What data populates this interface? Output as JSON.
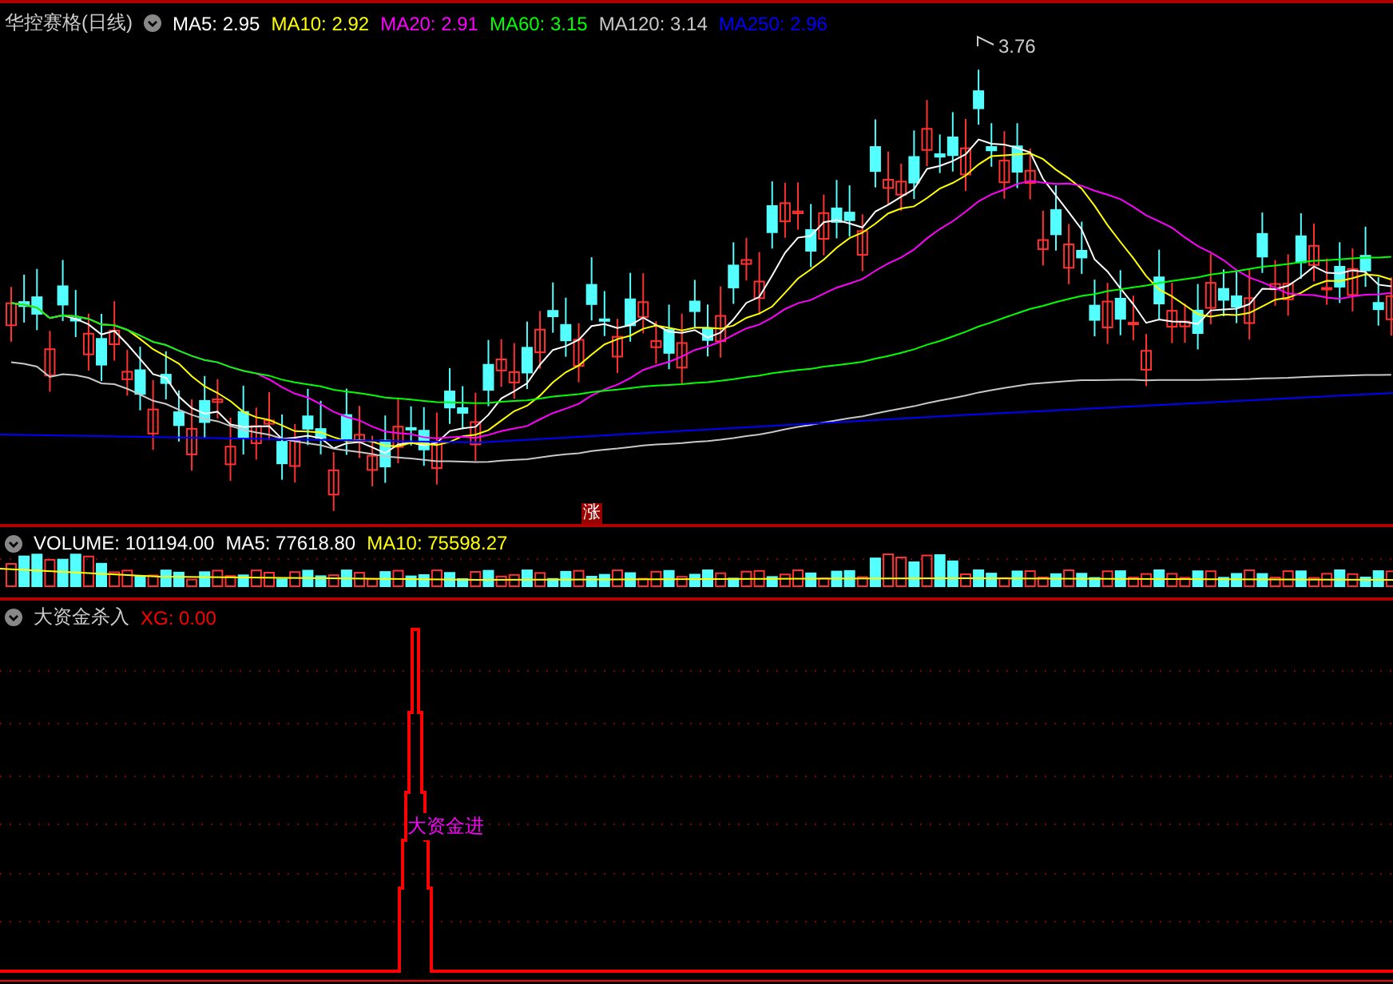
{
  "price_panel": {
    "title": "华控赛格(日线)",
    "legend": [
      {
        "label": "MA5: 2.95",
        "color": "#ffffff"
      },
      {
        "label": "MA10: 2.92",
        "color": "#ffff00"
      },
      {
        "label": "MA20: 2.91",
        "color": "#ff00ff"
      },
      {
        "label": "MA60: 3.15",
        "color": "#00ff00"
      },
      {
        "label": "MA120: 3.14",
        "color": "#c8c8c8"
      },
      {
        "label": "MA250: 2.96",
        "color": "#0000ff"
      }
    ],
    "peak_label": "3.76",
    "badge": "涨"
  },
  "volume_panel": {
    "legend": [
      {
        "label": "VOLUME: 101194.00",
        "color": "#ffffff"
      },
      {
        "label": "MA5: 77618.80",
        "color": "#ffffff"
      },
      {
        "label": "MA10: 75598.27",
        "color": "#ffff00"
      }
    ]
  },
  "indicator_panel": {
    "title": "大资金杀入",
    "legend": [
      {
        "label": "XG: 0.00",
        "color": "#ff0000"
      }
    ],
    "signal_label": "大资金进"
  }
}
